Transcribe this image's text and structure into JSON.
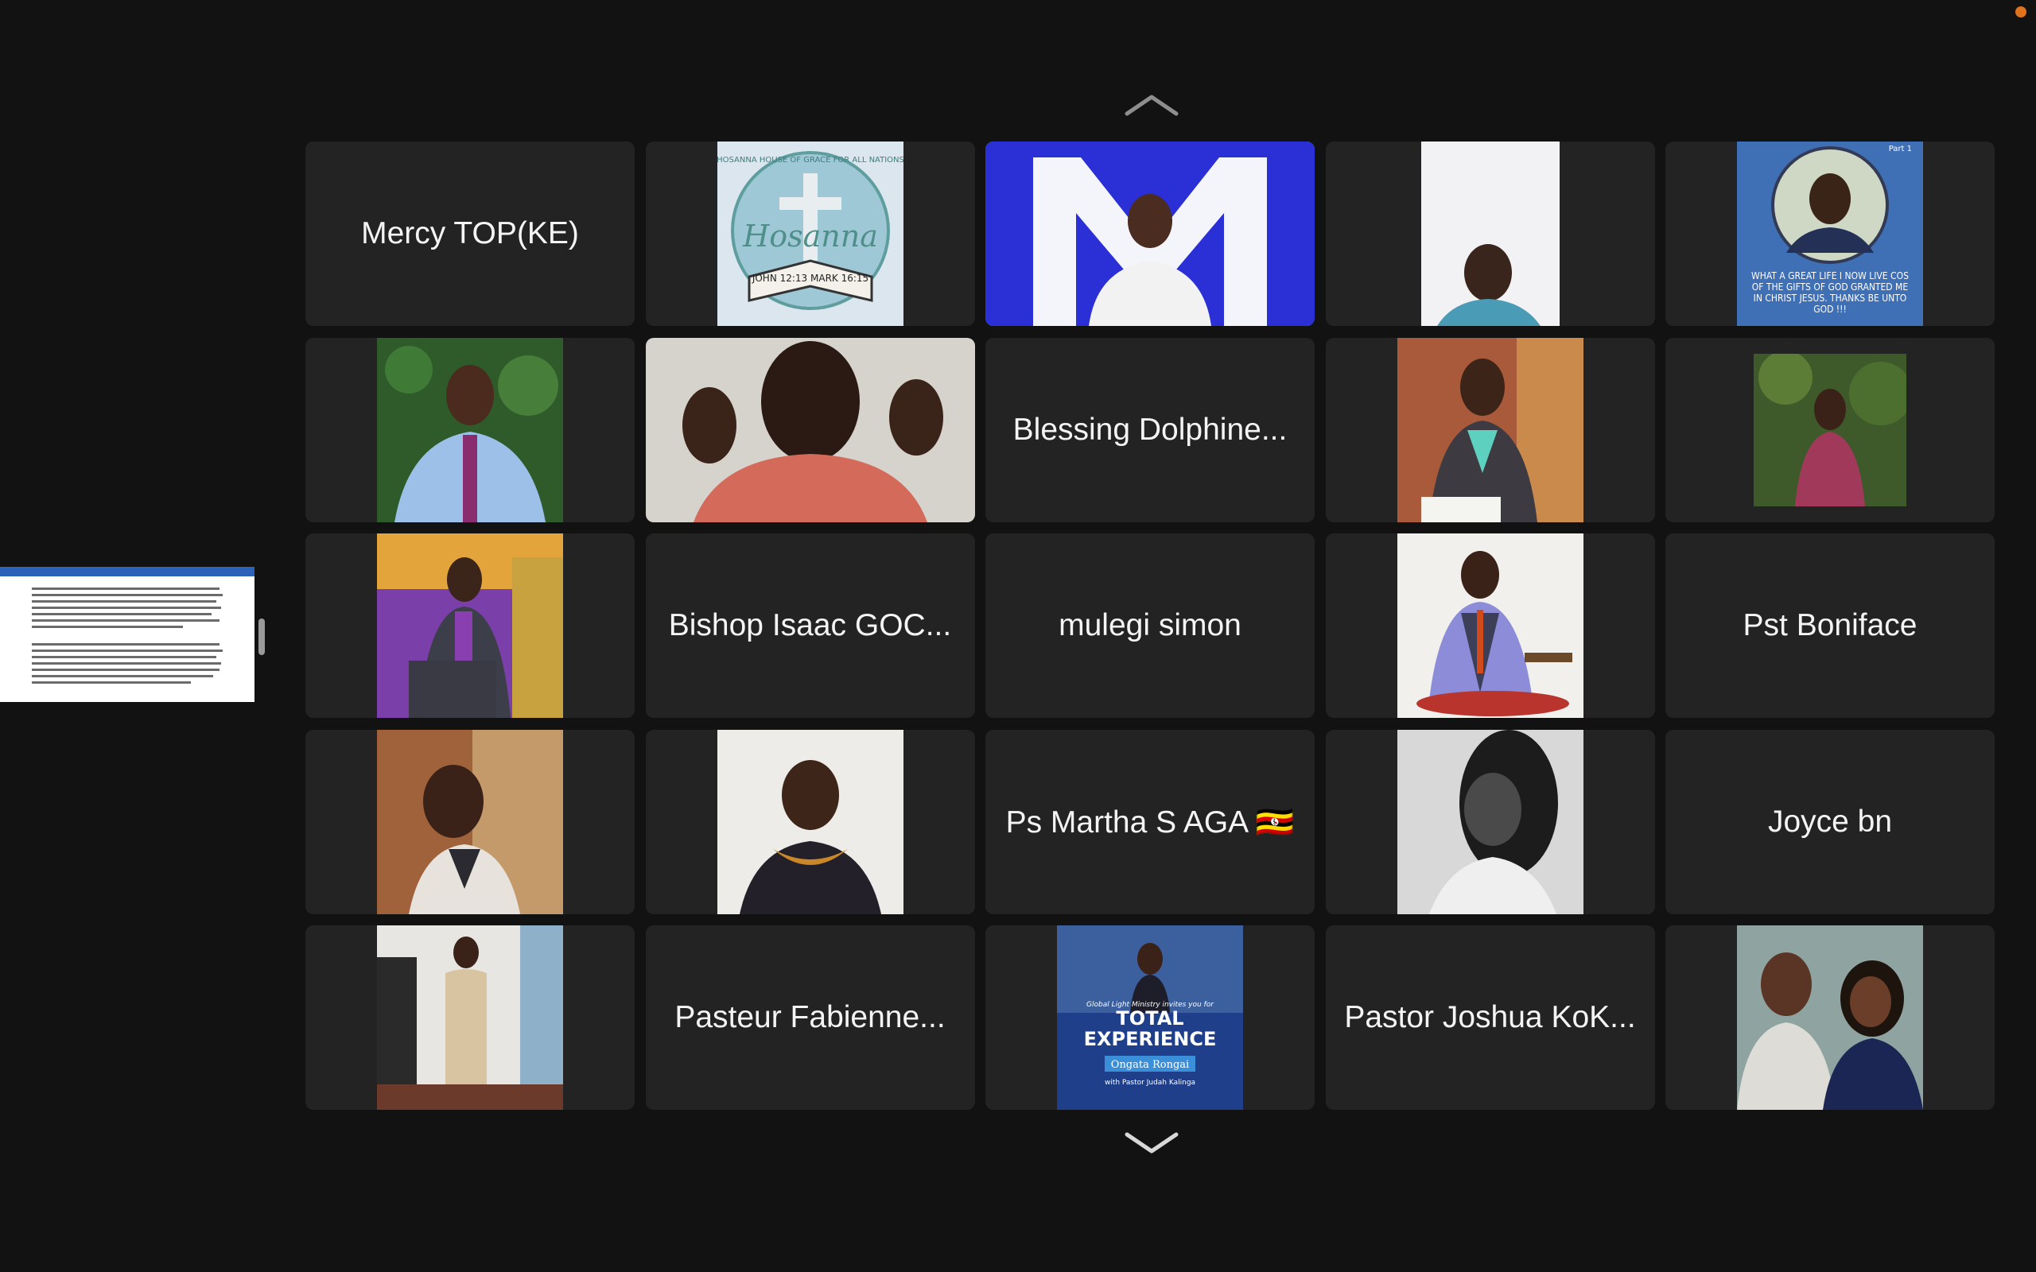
{
  "participants": [
    {
      "name": "Mercy TOP(KE)",
      "kind": "name"
    },
    {
      "name": "",
      "kind": "photo",
      "icon": "hosanna-logo-avatar",
      "caption_top": "HOSANNA HOUSE OF GRACE FOR ALL NATIONS",
      "caption_main": "Hosanna",
      "caption_bottom": "JOHN 12:13 MARK 16:15"
    },
    {
      "name": "",
      "kind": "video",
      "icon": "speaker-video",
      "speaking": true
    },
    {
      "name": "",
      "kind": "video",
      "icon": "woman-video"
    },
    {
      "name": "",
      "kind": "photo",
      "icon": "quote-portrait-avatar",
      "caption_top": "Part 1",
      "caption_main": "WHAT A GREAT LIFE I NOW LIVE COS OF THE GIFTS OF GOD GRANTED ME IN CHRIST JESUS. THANKS BE UNTO GOD !!!"
    },
    {
      "name": "",
      "kind": "photo",
      "icon": "man-blue-shirt-avatar"
    },
    {
      "name": "",
      "kind": "video",
      "icon": "man-gesturing-video"
    },
    {
      "name": "Blessing Dolphine...",
      "kind": "name"
    },
    {
      "name": "",
      "kind": "photo",
      "icon": "woman-seated-avatar"
    },
    {
      "name": "",
      "kind": "photo",
      "icon": "woman-garden-avatar"
    },
    {
      "name": "",
      "kind": "photo",
      "icon": "bishop-pulpit-avatar"
    },
    {
      "name": "Bishop Isaac GOC...",
      "kind": "name"
    },
    {
      "name": "mulegi simon",
      "kind": "name"
    },
    {
      "name": "",
      "kind": "photo",
      "icon": "man-chair-avatar"
    },
    {
      "name": "Pst Boniface",
      "kind": "name"
    },
    {
      "name": "",
      "kind": "photo",
      "icon": "man-smiling-avatar"
    },
    {
      "name": "",
      "kind": "photo",
      "icon": "woman-necklace-avatar"
    },
    {
      "name": "Ps Martha S AGA 🇺🇬",
      "kind": "name"
    },
    {
      "name": "",
      "kind": "photo",
      "icon": "woman-bw-avatar"
    },
    {
      "name": "Joyce bn",
      "kind": "name"
    },
    {
      "name": "",
      "kind": "photo",
      "icon": "man-suit-avatar"
    },
    {
      "name": "Pasteur Fabienne...",
      "kind": "name"
    },
    {
      "name": "",
      "kind": "photo",
      "icon": "event-poster-avatar",
      "caption_top": "Global Light Ministry invites you for",
      "caption_main": "TOTAL EXPERIENCE",
      "caption_sub": "Ongata Rongai",
      "caption_bottom": "with Pastor Judah Kalinga"
    },
    {
      "name": "Pastor Joshua KoK...",
      "kind": "name"
    },
    {
      "name": "",
      "kind": "photo",
      "icon": "couple-avatar"
    }
  ],
  "colors": {
    "background": "#121213",
    "tile": "#232324",
    "active_speaker_border": "#43d04d",
    "name_text": "#f4f4f4"
  },
  "controls": {
    "page_up_icon": "chevron-up-icon",
    "page_down_icon": "chevron-down-icon"
  }
}
